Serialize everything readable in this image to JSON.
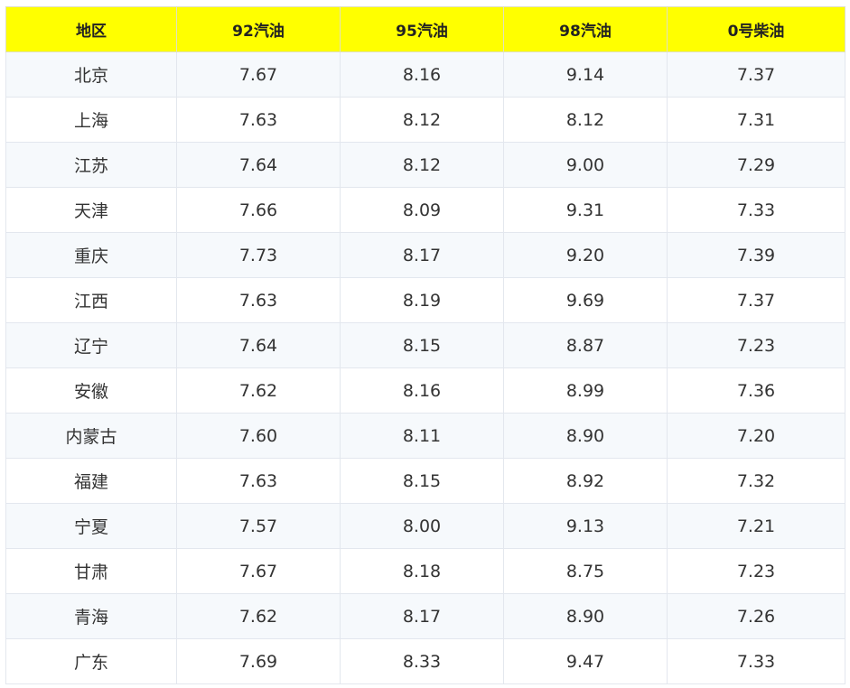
{
  "table": {
    "headers": [
      "地区",
      "92汽油",
      "95汽油",
      "98汽油",
      "0号柴油"
    ],
    "rows": [
      [
        "北京",
        "7.67",
        "8.16",
        "9.14",
        "7.37"
      ],
      [
        "上海",
        "7.63",
        "8.12",
        "8.12",
        "7.31"
      ],
      [
        "江苏",
        "7.64",
        "8.12",
        "9.00",
        "7.29"
      ],
      [
        "天津",
        "7.66",
        "8.09",
        "9.31",
        "7.33"
      ],
      [
        "重庆",
        "7.73",
        "8.17",
        "9.20",
        "7.39"
      ],
      [
        "江西",
        "7.63",
        "8.19",
        "9.69",
        "7.37"
      ],
      [
        "辽宁",
        "7.64",
        "8.15",
        "8.87",
        "7.23"
      ],
      [
        "安徽",
        "7.62",
        "8.16",
        "8.99",
        "7.36"
      ],
      [
        "内蒙古",
        "7.60",
        "8.11",
        "8.90",
        "7.20"
      ],
      [
        "福建",
        "7.63",
        "8.15",
        "8.92",
        "7.32"
      ],
      [
        "宁夏",
        "7.57",
        "8.00",
        "9.13",
        "7.21"
      ],
      [
        "甘肃",
        "7.67",
        "8.18",
        "8.75",
        "7.23"
      ],
      [
        "青海",
        "7.62",
        "8.17",
        "8.90",
        "7.26"
      ],
      [
        "广东",
        "7.69",
        "8.33",
        "9.47",
        "7.33"
      ]
    ]
  },
  "colors": {
    "header_bg": "#ffff00",
    "row_alt_bg": "#f6f9fc",
    "border": "#e3e7ee"
  }
}
